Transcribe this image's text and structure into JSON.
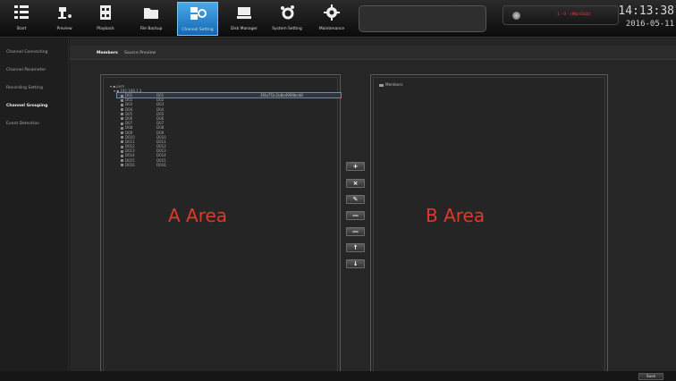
{
  "toolbar": {
    "items": [
      {
        "label": "Start",
        "icon": "menu-icon"
      },
      {
        "label": "Preview",
        "icon": "camera-icon"
      },
      {
        "label": "Playback",
        "icon": "film-icon"
      },
      {
        "label": "File Backup",
        "icon": "folder-icon"
      },
      {
        "label": "Channel Setting",
        "icon": "channel-setting-icon"
      },
      {
        "label": "Disk Manager",
        "icon": "disk-icon"
      },
      {
        "label": "System Setting",
        "icon": "system-setting-icon"
      },
      {
        "label": "Maintenance",
        "icon": "gear-icon"
      }
    ],
    "active_index": 4
  },
  "status": {
    "text": "1 - 0 - (Mbr/Gbit)",
    "time": "14:13:38",
    "date": "2016-05-11"
  },
  "sidebar": {
    "items": [
      {
        "label": "Channel Connecting"
      },
      {
        "label": "Channel Parameter"
      },
      {
        "label": "Recording Setting"
      },
      {
        "label": "Channel Grouping"
      },
      {
        "label": "Event Detection"
      }
    ],
    "active_index": 3
  },
  "subtabs": {
    "items": [
      {
        "label": "Members"
      },
      {
        "label": "Source Preview"
      }
    ],
    "active_index": 0
  },
  "panelA": {
    "root": "pvm",
    "group": "192.168.1.3",
    "rows": [
      {
        "c1": "D01",
        "c2": "D01",
        "c3": "3f4a7f3c1b8e4969bcd8"
      },
      {
        "c1": "D02",
        "c2": "D02",
        "c3": ""
      },
      {
        "c1": "D03",
        "c2": "D03",
        "c3": ""
      },
      {
        "c1": "D04",
        "c2": "D04",
        "c3": ""
      },
      {
        "c1": "D05",
        "c2": "D05",
        "c3": ""
      },
      {
        "c1": "D06",
        "c2": "D06",
        "c3": ""
      },
      {
        "c1": "D07",
        "c2": "D07",
        "c3": ""
      },
      {
        "c1": "D08",
        "c2": "D08",
        "c3": ""
      },
      {
        "c1": "D09",
        "c2": "D09",
        "c3": ""
      },
      {
        "c1": "D010",
        "c2": "D010",
        "c3": ""
      },
      {
        "c1": "D011",
        "c2": "D011",
        "c3": ""
      },
      {
        "c1": "D012",
        "c2": "D012",
        "c3": ""
      },
      {
        "c1": "D013",
        "c2": "D013",
        "c3": ""
      },
      {
        "c1": "D014",
        "c2": "D014",
        "c3": ""
      },
      {
        "c1": "D015",
        "c2": "D015",
        "c3": ""
      },
      {
        "c1": "D016",
        "c2": "D016",
        "c3": ""
      }
    ]
  },
  "annotations": {
    "area_a": "A Area",
    "area_b": "B Area"
  },
  "panelB": {
    "header": "Members"
  },
  "actions": [
    {
      "symbol": "+",
      "icon": "add-icon"
    },
    {
      "symbol": "×",
      "icon": "delete-icon"
    },
    {
      "symbol": "✎",
      "icon": "edit-icon"
    },
    {
      "symbol": "—",
      "icon": "move-right-icon"
    },
    {
      "symbol": "—",
      "icon": "move-left-icon"
    },
    {
      "symbol": "↑",
      "icon": "arrow-up-icon"
    },
    {
      "symbol": "↓",
      "icon": "arrow-down-icon"
    }
  ],
  "footer": {
    "save_label": "Save"
  }
}
